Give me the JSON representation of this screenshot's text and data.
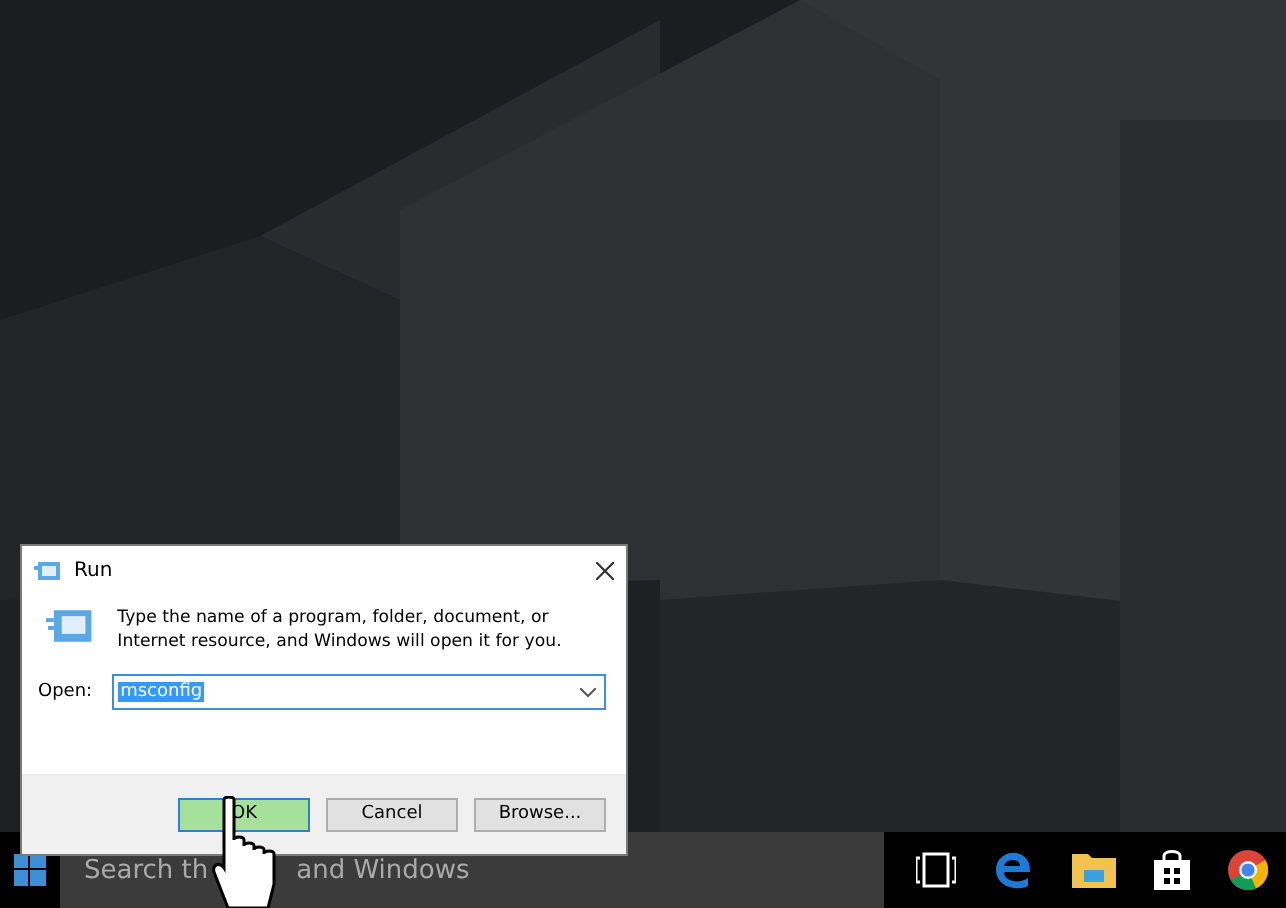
{
  "dialog": {
    "title": "Run",
    "message": "Type the name of a program, folder, document, or Internet resource, and Windows will open it for you.",
    "open_label": "Open:",
    "open_value": "msconfig",
    "value_selected": true,
    "buttons": [
      {
        "label": "OK",
        "selected": true
      },
      {
        "label": "Cancel",
        "selected": false
      },
      {
        "label": "Browse...",
        "selected": false
      }
    ]
  },
  "taskbar": {
    "search_parts": [
      "Search th",
      "and Windows"
    ]
  }
}
